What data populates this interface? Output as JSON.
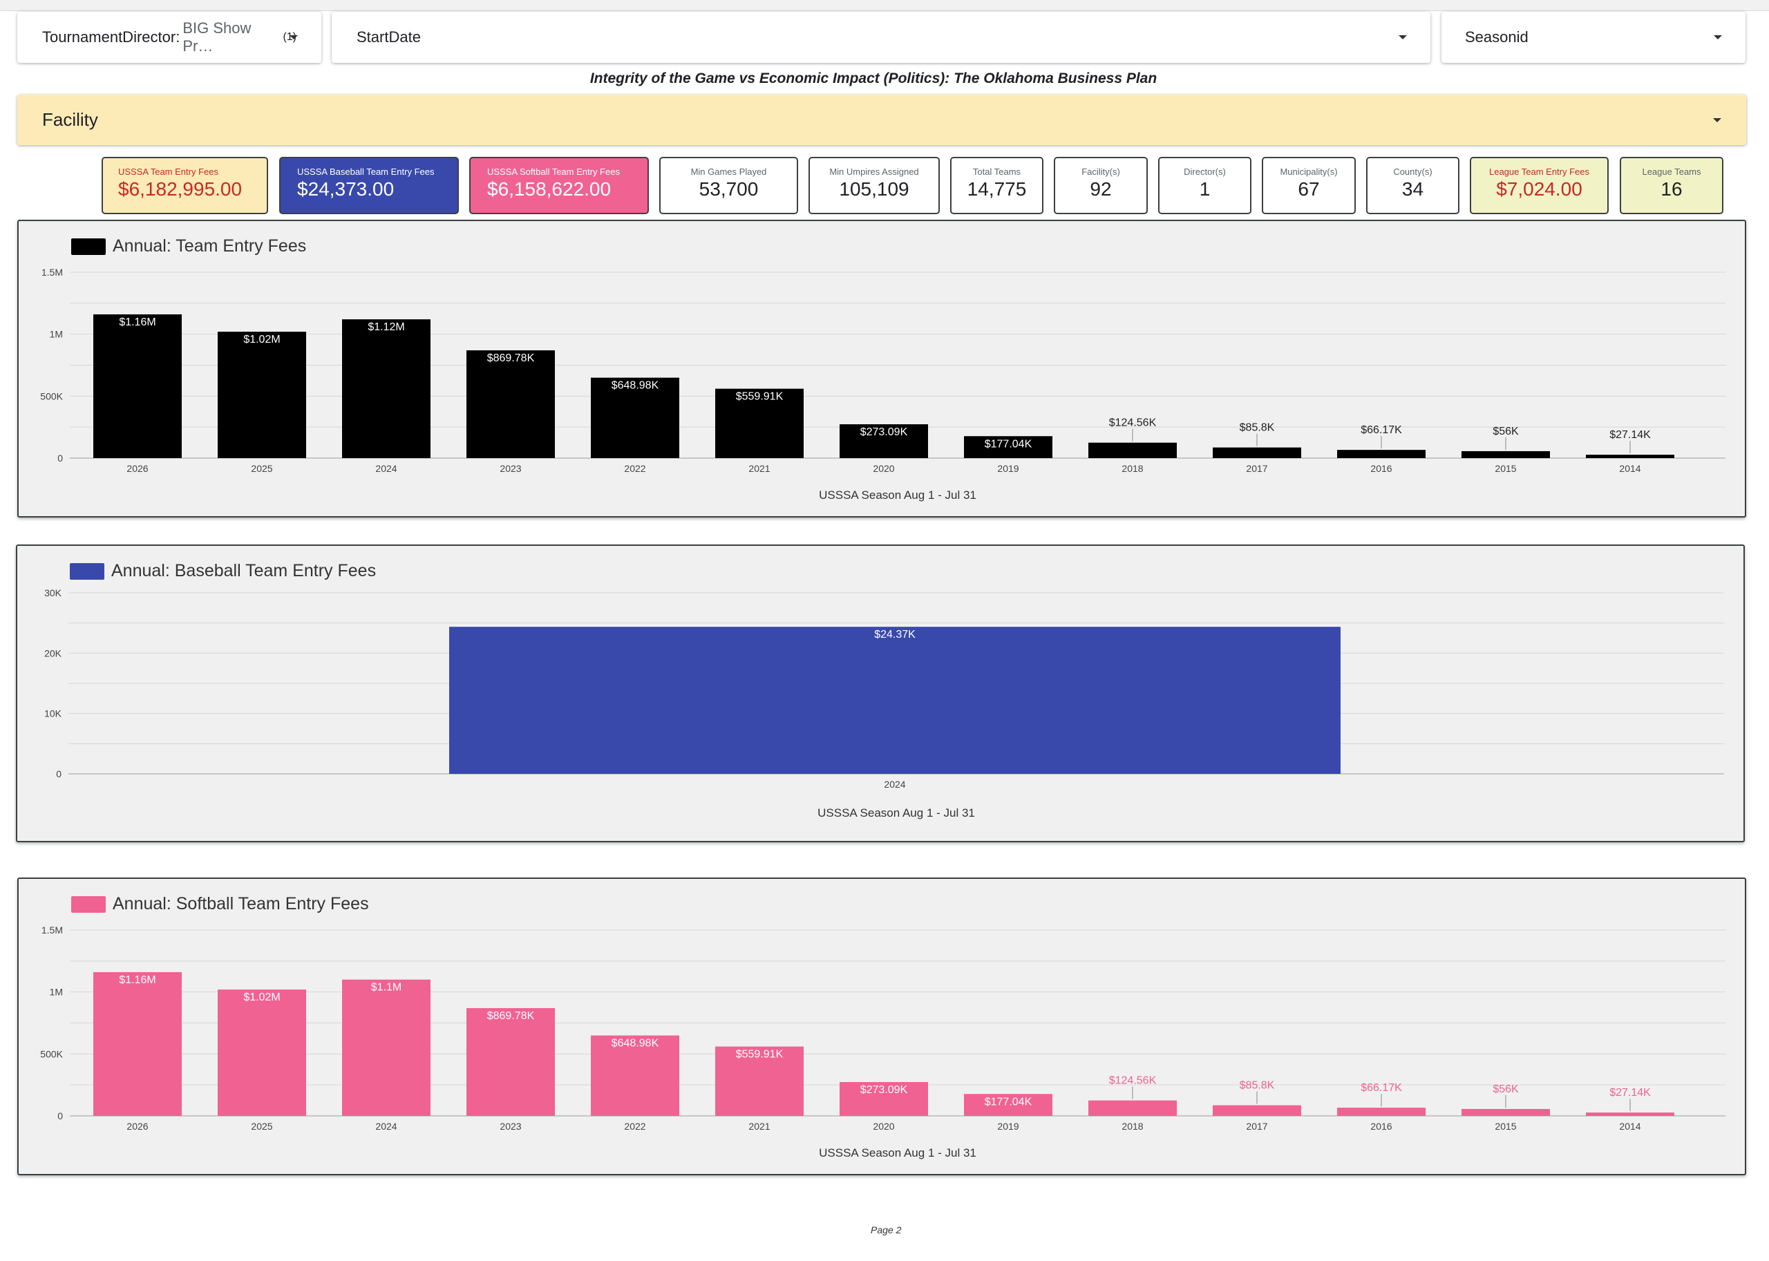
{
  "filters": {
    "director_label": "TournamentDirector:",
    "director_value": "BIG Show Pr…",
    "director_count": "(1)",
    "startdate_label": "StartDate",
    "seasonid_label": "Seasonid"
  },
  "subtitle": "Integrity of the Game vs Economic Impact (Politics): The Oklahoma Business Plan",
  "facility_label": "Facility",
  "kpis": [
    {
      "label": "USSSA Team Entry Fees",
      "value": "$6,182,995.00"
    },
    {
      "label": "USSSA Baseball Team Entry Fees",
      "value": "$24,373.00"
    },
    {
      "label": "USSSA Softball Team Entry Fees",
      "value": "$6,158,622.00"
    },
    {
      "label": "Min Games Played",
      "value": "53,700"
    },
    {
      "label": "Min Umpires Assigned",
      "value": "105,109"
    },
    {
      "label": "Total Teams",
      "value": "14,775"
    },
    {
      "label": "Facility(s)",
      "value": "92"
    },
    {
      "label": "Director(s)",
      "value": "1"
    },
    {
      "label": "Municipality(s)",
      "value": "67"
    },
    {
      "label": "County(s)",
      "value": "34"
    },
    {
      "label": "League Team Entry Fees",
      "value": "$7,024.00"
    },
    {
      "label": "League Teams",
      "value": "16"
    }
  ],
  "colors": {
    "yellow_card": "#fdebb7",
    "baseball_blue": "#3949ab",
    "softball_pink": "#f06292",
    "fee_red": "#c62828",
    "league_green": "#f1f3c6",
    "black": "#000000"
  },
  "chart_data": [
    {
      "type": "bar",
      "legend": "Annual: Team Entry Fees",
      "xlabel": "USSSA Season Aug 1 - Jul 31",
      "ylim": [
        0,
        1500000
      ],
      "yticks": [
        "0",
        "500K",
        "1M",
        "1.5M"
      ],
      "categories": [
        "2026",
        "2025",
        "2024",
        "2023",
        "2022",
        "2021",
        "2020",
        "2019",
        "2018",
        "2017",
        "2016",
        "2015",
        "2014"
      ],
      "values": [
        1160000,
        1020000,
        1120000,
        869780,
        648980,
        559910,
        273090,
        177040,
        124560,
        85800,
        66170,
        56000,
        27140
      ],
      "labels": [
        "$1.16M",
        "$1.02M",
        "$1.12M",
        "$869.78K",
        "$648.98K",
        "$559.91K",
        "$273.09K",
        "$177.04K",
        "$124.56K",
        "$85.8K",
        "$66.17K",
        "$56K",
        "$27.14K"
      ],
      "color": "#000000"
    },
    {
      "type": "bar",
      "legend": "Annual: Baseball Team Entry Fees",
      "xlabel": "USSSA Season Aug 1 - Jul 31",
      "ylim": [
        0,
        30000
      ],
      "yticks": [
        "0",
        "10K",
        "20K",
        "30K"
      ],
      "categories": [
        "2024"
      ],
      "values": [
        24373
      ],
      "labels": [
        "$24.37K"
      ],
      "color": "#3949ab"
    },
    {
      "type": "bar",
      "legend": "Annual: Softball Team Entry Fees",
      "xlabel": "USSSA Season Aug 1 - Jul 31",
      "ylim": [
        0,
        1500000
      ],
      "yticks": [
        "0",
        "500K",
        "1M",
        "1.5M"
      ],
      "categories": [
        "2026",
        "2025",
        "2024",
        "2023",
        "2022",
        "2021",
        "2020",
        "2019",
        "2018",
        "2017",
        "2016",
        "2015",
        "2014"
      ],
      "values": [
        1160000,
        1020000,
        1100000,
        869780,
        648980,
        559910,
        273090,
        177040,
        124560,
        85800,
        66170,
        56000,
        27140
      ],
      "labels": [
        "$1.16M",
        "$1.02M",
        "$1.1M",
        "$869.78K",
        "$648.98K",
        "$559.91K",
        "$273.09K",
        "$177.04K",
        "$124.56K",
        "$85.8K",
        "$66.17K",
        "$56K",
        "$27.14K"
      ],
      "color": "#f06292"
    }
  ],
  "page_footer": "Page 2"
}
